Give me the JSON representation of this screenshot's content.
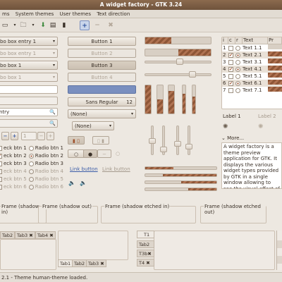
{
  "window": {
    "title": "A widget factory - GTK 3.24"
  },
  "menu": [
    "ms",
    "System themes",
    "User themes",
    "Text direction"
  ],
  "toolbar": {
    "icons": [
      "open-icon",
      "paste-icon",
      "down-arrow-icon",
      "pointer-icon",
      "add-icon",
      "minus-icon",
      "close-icon"
    ]
  },
  "left": {
    "combo_entry_1": "bo box entry 1",
    "combo_entry_1_dis": "bo box entry 1",
    "combo_1": "bo box 1",
    "combo_1_dis": "bo box 1",
    "entry_blank": "",
    "entry_blank_dis": "",
    "search_entry": "ntry",
    "search_entry_dis": "",
    "spin_value": "1",
    "spin_value_dis": "1",
    "checks": [
      "eck btn 1",
      "eck btn 2",
      "eck btn 3",
      "eck btn 4",
      "eck btn 5",
      "eck btn 6"
    ],
    "radios": [
      "Radio btn 1",
      "Radio btn 2",
      "Radio btn 3",
      "Radio btn 4",
      "Radio btn 5",
      "Radio btn 6"
    ]
  },
  "middle": {
    "buttons": [
      "Button 1",
      "Button 2",
      "Button 3",
      "Button 4"
    ],
    "font_name": "Sans Regular",
    "font_size": "12",
    "combo_none_1": "(None)",
    "combo_none_2": "(None)",
    "link": "Link button",
    "link_dis": "Link button"
  },
  "tree": {
    "headers": [
      "i",
      "c",
      "r",
      "Text",
      "Pr"
    ],
    "rows": [
      {
        "i": "1",
        "text": "Text 1.1"
      },
      {
        "i": "2",
        "text": "Text 2.1"
      },
      {
        "i": "3",
        "text": "Text 3.1"
      },
      {
        "i": "4",
        "text": "Text 4.1"
      },
      {
        "i": "5",
        "text": "Text 5.1"
      },
      {
        "i": "6",
        "text": "Text 6.1"
      },
      {
        "i": "7",
        "text": "Text 7.1"
      }
    ],
    "label1": "Label 1",
    "label2": "Label 2",
    "more": "More...",
    "description": "A widget factory is a theme preview application for GTK. It displays the various widget types provided by GTK in a single window allowing to see the visual effect of th"
  },
  "frames": [
    "Frame (shadow in)",
    "Frame (shadow out)",
    "Frame (shadow etched in)",
    "Frame (shadow etched out)"
  ],
  "notebooks": {
    "nb1_tabs": [
      "Tab2",
      "Tab3",
      "Tab4"
    ],
    "nb2_tabs": [
      "Tab1",
      "Tab2",
      "Tab3"
    ],
    "nb3_tabs": [
      "T1",
      "Tab2",
      "T3b",
      "T4"
    ]
  },
  "status": "2.1 - Theme human-theme loaded.",
  "colors": {
    "accent": "#a0522d",
    "title": "#7a5c43",
    "selection": "#7a8fbf"
  }
}
